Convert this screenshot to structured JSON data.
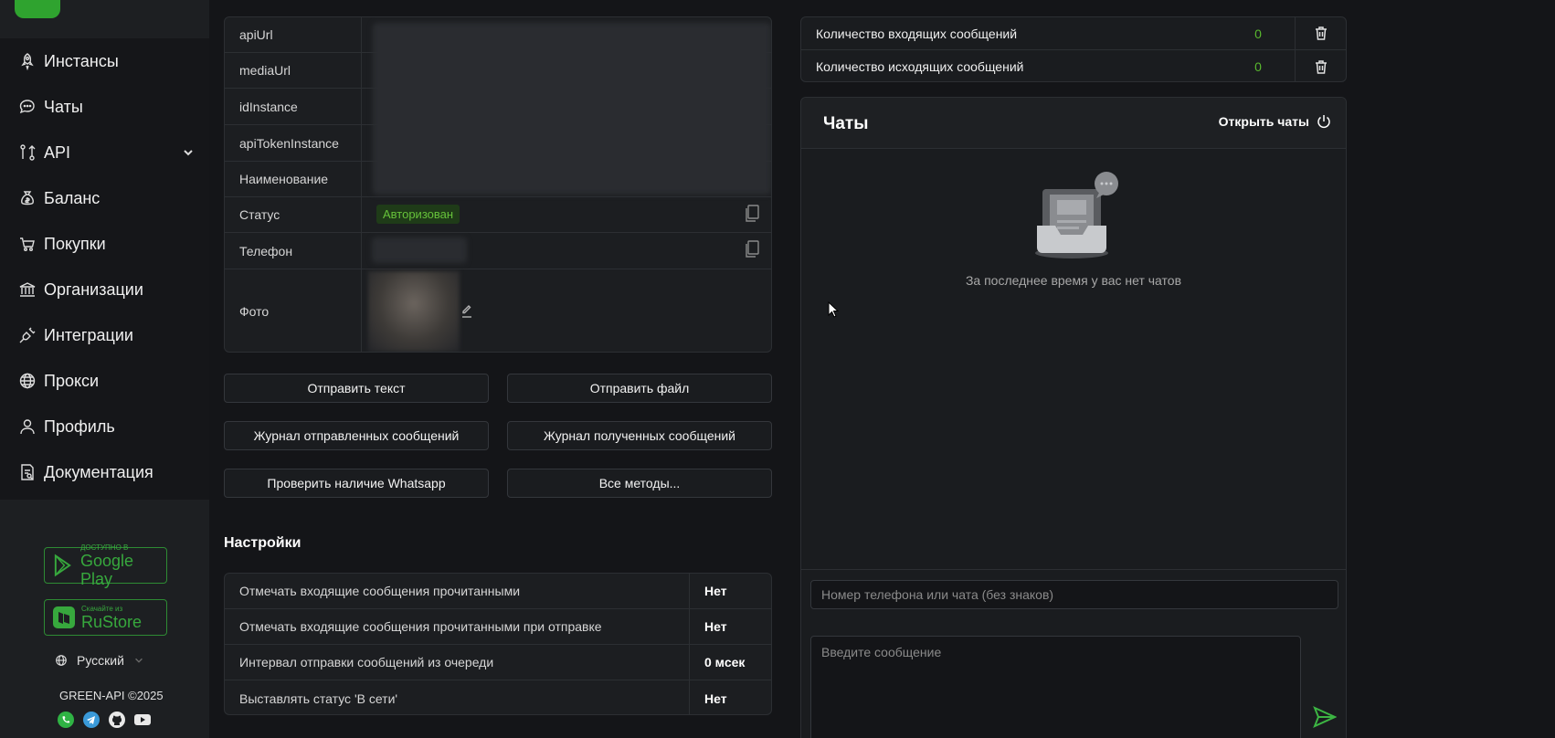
{
  "sidebar": {
    "items": [
      {
        "label": "Инстансы",
        "icon": "rocket-icon"
      },
      {
        "label": "Чаты",
        "icon": "chat-icon"
      },
      {
        "label": "API",
        "icon": "api-icon"
      },
      {
        "label": "Баланс",
        "icon": "money-bag-icon"
      },
      {
        "label": "Покупки",
        "icon": "cart-icon"
      },
      {
        "label": "Организации",
        "icon": "bank-icon"
      },
      {
        "label": "Интеграции",
        "icon": "plug-icon"
      },
      {
        "label": "Прокси",
        "icon": "globe-icon"
      },
      {
        "label": "Профиль",
        "icon": "user-icon"
      },
      {
        "label": "Документация",
        "icon": "document-icon"
      }
    ],
    "google_play": {
      "small": "ДОСТУПНО В",
      "big": "Google Play"
    },
    "rustore": {
      "small": "Скачайте из",
      "big": "RuStore"
    },
    "language": "Русский",
    "copyright": "GREEN-API ©2025"
  },
  "instance": {
    "rows": [
      {
        "key": "apiUrl"
      },
      {
        "key": "mediaUrl"
      },
      {
        "key": "idInstance"
      },
      {
        "key": "apiTokenInstance"
      },
      {
        "key": "Наименование"
      },
      {
        "key": "Статус",
        "value": "Авторизован"
      },
      {
        "key": "Телефон"
      },
      {
        "key": "Фото"
      }
    ]
  },
  "actions": {
    "send_text": "Отправить текст",
    "send_file": "Отправить файл",
    "sent_log": "Журнал отправленных сообщений",
    "received_log": "Журнал полученных сообщений",
    "check_whatsapp": "Проверить наличие Whatsapp",
    "all_methods": "Все методы..."
  },
  "settings": {
    "title": "Настройки",
    "rows": [
      {
        "label": "Отмечать входящие сообщения прочитанными",
        "value": "Нет"
      },
      {
        "label": "Отмечать входящие сообщения прочитанными при отправке",
        "value": "Нет"
      },
      {
        "label": "Интервал отправки сообщений из очереди",
        "value": "0 мсек"
      },
      {
        "label": "Выставлять статус 'В сети'",
        "value": "Нет"
      }
    ]
  },
  "counters": {
    "incoming_label": "Количество входящих сообщений",
    "incoming_value": "0",
    "outgoing_label": "Количество исходящих сообщений",
    "outgoing_value": "0"
  },
  "chats": {
    "title": "Чаты",
    "open_label": "Открыть чаты",
    "empty_text": "За последнее время у вас нет чатов",
    "phone_placeholder": "Номер телефона или чата (без знаков)",
    "message_placeholder": "Введите сообщение"
  },
  "colors": {
    "accent_green": "#59b82e",
    "background": "#141518",
    "panel": "#1c1e21"
  }
}
